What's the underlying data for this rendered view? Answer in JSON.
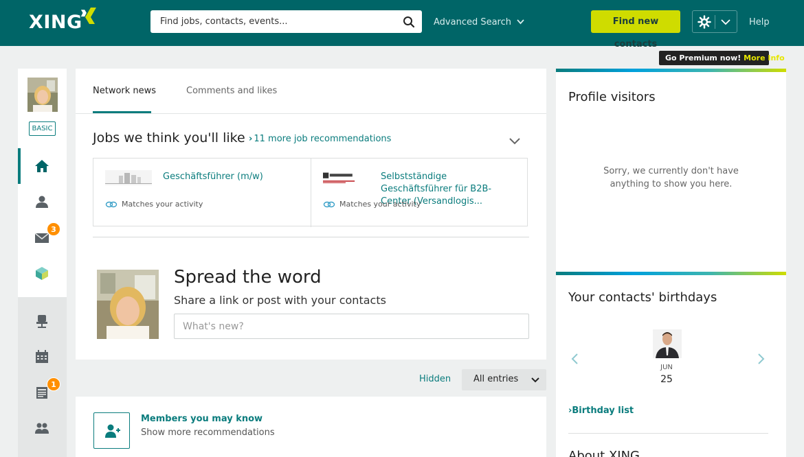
{
  "header": {
    "logo": "XING",
    "search_placeholder": "Find jobs, contacts, events...",
    "advanced_search": "Advanced Search",
    "find_contacts": "Find new contacts",
    "help": "Help",
    "premium_text": "Go Premium now!",
    "premium_link": "More Info"
  },
  "sidebar": {
    "badge": "BASIC",
    "messages_count": "3",
    "news_count": "1"
  },
  "tabs": {
    "network_news": "Network news",
    "comments_likes": "Comments and likes"
  },
  "jobs": {
    "title": "Jobs we think you'll like",
    "more_link": "11 more job recommendations",
    "items": [
      {
        "title": "Geschäftsführer (m/w)",
        "match": "Matches your activity"
      },
      {
        "title": "Selbstständige Geschäftsführer für B2B-Center (Versandlogis...",
        "match": "Matches your activity"
      }
    ]
  },
  "spread": {
    "title": "Spread the word",
    "subtitle": "Share a link or post with your contacts",
    "placeholder": "What's new?"
  },
  "filter": {
    "hidden": "Hidden",
    "selected": "All entries"
  },
  "members": {
    "title": "Members you may know",
    "subtitle": "Show more recommendations"
  },
  "visitors": {
    "title": "Profile visitors",
    "empty_line1": "Sorry, we currently don't have",
    "empty_line2": "anything to show you here."
  },
  "birthdays": {
    "title": "Your contacts' birthdays",
    "month": "JUN",
    "day": "25",
    "list_link": "Birthday list",
    "next_section_title": "About XING"
  },
  "colors": {
    "brand": "#006567",
    "accent": "#0a7c7d",
    "cta": "#cfdc00",
    "badge": "#ff8f00"
  }
}
